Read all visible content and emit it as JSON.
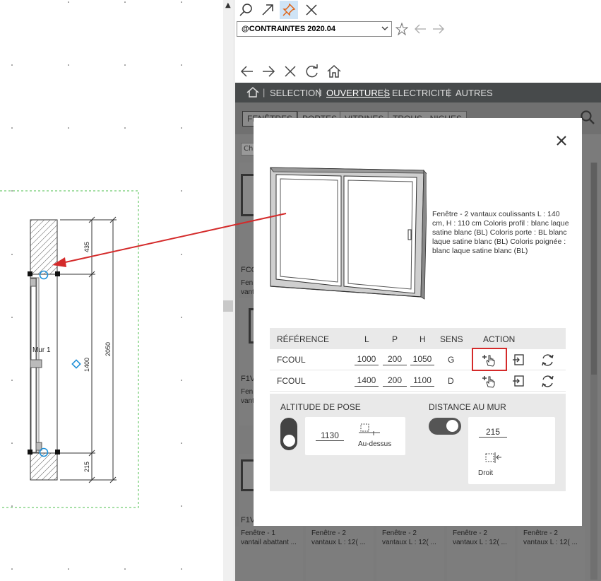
{
  "cad": {
    "wall_label": "Mur 1",
    "dim_top": "435",
    "dim_mid": "1400",
    "dim_bottom": "215",
    "dim_total": "2050"
  },
  "toolbar": {
    "search_icon": "search-icon",
    "expand_icon": "arrow-up-right-icon",
    "pin_icon": "pin-icon",
    "close_icon": "close-icon",
    "combo_value": "@CONTRAINTES 2020.04"
  },
  "menu": {
    "items": [
      "SELECTION",
      "OUVERTURES",
      "ELECTRICITE",
      "AUTRES"
    ],
    "active": "OUVERTURES"
  },
  "subtabs": [
    "FENÊTRES",
    "PORTES",
    "VITRINES",
    "TROUS - NICHES"
  ],
  "filter_placeholder": "Ch",
  "cards": [
    {
      "title": "FCC",
      "desc": "Fen vant"
    },
    {
      "title": "F1V",
      "desc": "Fen vant"
    },
    {
      "title": "F1V",
      "desc": ""
    }
  ],
  "bottom_cards": [
    {
      "desc": "Fenêtre - 1 vantail abattant ..."
    },
    {
      "desc": "Fenêtre - 2 vantaux L : 12( ..."
    },
    {
      "desc": "Fenêtre - 2 vantaux L : 12( ..."
    },
    {
      "desc": "Fenêtre - 2 vantaux L : 12( ..."
    },
    {
      "desc": "Fenêtre - 2 vantaux L : 12( ..."
    }
  ],
  "modal": {
    "description": "Fenêtre - 2 vantaux coulissants L : 140 cm, H : 110 cm Coloris profil : blanc laque satine blanc (BL) Coloris porte : BL blanc laque satine blanc (BL) Coloris poignée : blanc laque satine blanc (BL)",
    "headers": {
      "ref": "RÉFÉRENCE",
      "l": "L",
      "p": "P",
      "h": "H",
      "sens": "SENS",
      "action": "ACTION"
    },
    "rows": [
      {
        "ref": "FCOUL",
        "l": "1000",
        "p": "200",
        "h": "1050",
        "sens": "G"
      },
      {
        "ref": "FCOUL",
        "l": "1400",
        "p": "200",
        "h": "1100",
        "sens": "D"
      }
    ],
    "altitude_label": "ALTITUDE DE POSE",
    "altitude_value": "1130",
    "altitude_caption": "Au-dessus",
    "distance_label": "DISTANCE AU MUR",
    "distance_value": "215",
    "distance_caption": "Droit",
    "accent": "#d42a2a"
  }
}
